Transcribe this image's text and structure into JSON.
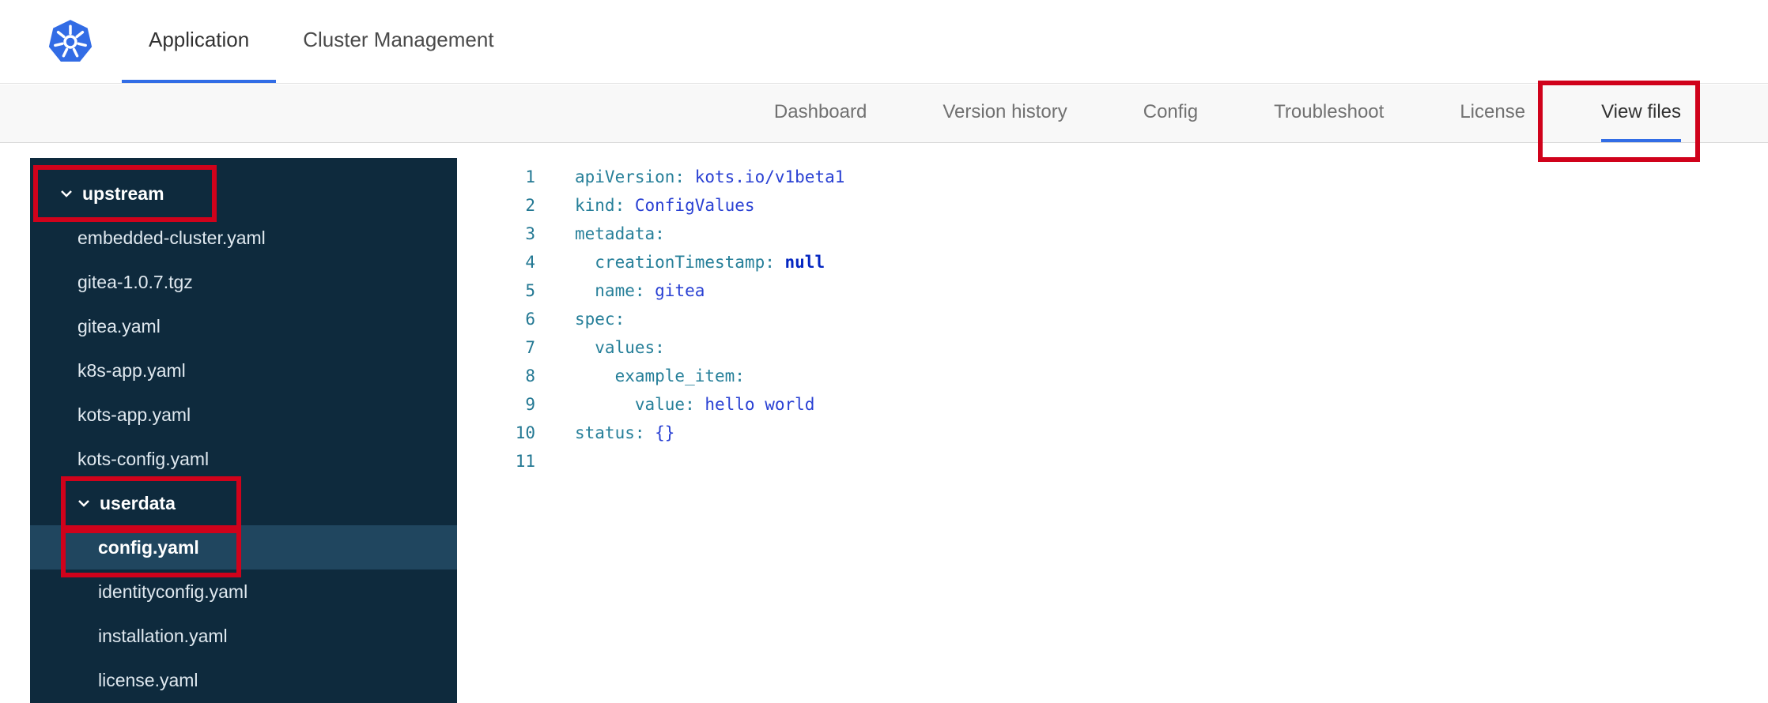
{
  "colors": {
    "accent_blue": "#326de6",
    "annotation_red": "#d0021b",
    "sidebar_bg": "#0e2a3d",
    "sidebar_selected_bg": "#20465f",
    "yaml_key": "#267f99",
    "yaml_string": "#2940d3",
    "yaml_keyword": "#0426c1",
    "line_number": "#237893"
  },
  "header": {
    "logo_icon": "kubernetes-helm-wheel",
    "tabs": [
      {
        "label": "Application",
        "active": true
      },
      {
        "label": "Cluster Management",
        "active": false
      }
    ]
  },
  "subnav": {
    "tabs": [
      {
        "label": "Dashboard",
        "active": false
      },
      {
        "label": "Version history",
        "active": false
      },
      {
        "label": "Config",
        "active": false
      },
      {
        "label": "Troubleshoot",
        "active": false
      },
      {
        "label": "License",
        "active": false
      },
      {
        "label": "View files",
        "active": true,
        "annotated": true
      }
    ]
  },
  "file_tree": {
    "items": [
      {
        "label": "upstream",
        "type": "folder",
        "level": 0,
        "expanded": true,
        "annotated": true
      },
      {
        "label": "embedded-cluster.yaml",
        "type": "file",
        "level": 1
      },
      {
        "label": "gitea-1.0.7.tgz",
        "type": "file",
        "level": 1
      },
      {
        "label": "gitea.yaml",
        "type": "file",
        "level": 1
      },
      {
        "label": "k8s-app.yaml",
        "type": "file",
        "level": 1
      },
      {
        "label": "kots-app.yaml",
        "type": "file",
        "level": 1
      },
      {
        "label": "kots-config.yaml",
        "type": "file",
        "level": 1
      },
      {
        "label": "userdata",
        "type": "folder",
        "level": 1,
        "expanded": true,
        "annotated": true
      },
      {
        "label": "config.yaml",
        "type": "file",
        "level": 2,
        "selected": true,
        "annotated": true
      },
      {
        "label": "identityconfig.yaml",
        "type": "file",
        "level": 2
      },
      {
        "label": "installation.yaml",
        "type": "file",
        "level": 2
      },
      {
        "label": "license.yaml",
        "type": "file",
        "level": 2
      }
    ]
  },
  "editor": {
    "language": "yaml",
    "lines": [
      {
        "num": "1",
        "key": "apiVersion:",
        "value": " kots.io/v1beta1",
        "vtype": "str"
      },
      {
        "num": "2",
        "key": "kind:",
        "value": " ConfigValues",
        "vtype": "str"
      },
      {
        "num": "3",
        "key": "metadata:",
        "value": "",
        "vtype": ""
      },
      {
        "num": "4",
        "key": "  creationTimestamp:",
        "value": " null",
        "vtype": "kw"
      },
      {
        "num": "5",
        "key": "  name:",
        "value": " gitea",
        "vtype": "str"
      },
      {
        "num": "6",
        "key": "spec:",
        "value": "",
        "vtype": ""
      },
      {
        "num": "7",
        "key": "  values:",
        "value": "",
        "vtype": ""
      },
      {
        "num": "8",
        "key": "    example_item:",
        "value": "",
        "vtype": ""
      },
      {
        "num": "9",
        "key": "      value:",
        "value": " hello world",
        "vtype": "str"
      },
      {
        "num": "10",
        "key": "status:",
        "value": " {}",
        "vtype": "brace"
      },
      {
        "num": "11",
        "key": "",
        "value": "",
        "vtype": ""
      }
    ]
  }
}
